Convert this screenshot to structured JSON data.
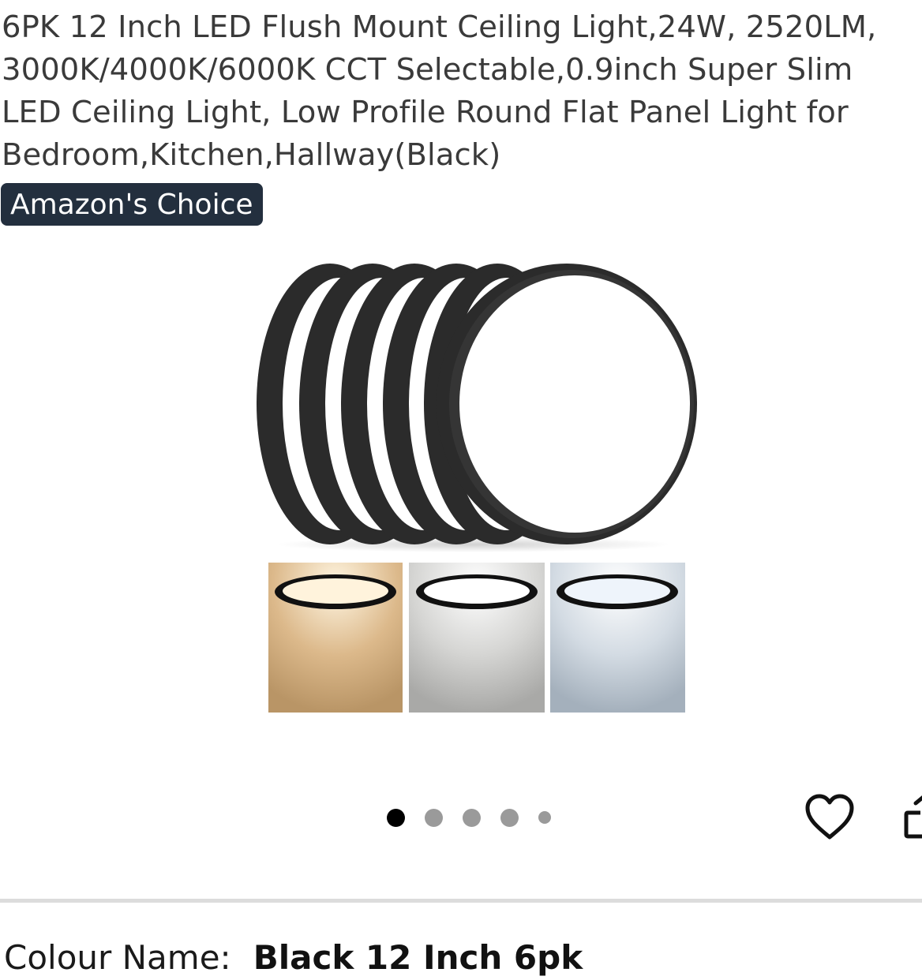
{
  "product": {
    "title": "6PK 12 Inch LED Flush Mount Ceiling Light,24W, 2520LM, 3000K/4000K/6000K CCT Selectable,0.9inch Super Slim LED Ceiling Light, Low Profile Round Flat Panel Light for Bedroom,Kitchen,Hallway(Black)",
    "badge": "Amazon's Choice"
  },
  "gallery": {
    "image_count": 5,
    "active_index": 0,
    "swatch_tints": [
      "#e8c9a0",
      "#dcdcdc",
      "#cfd8e2"
    ]
  },
  "actions": {
    "favorite_icon": "heart-icon",
    "share_icon": "share-icon"
  },
  "variation": {
    "label": "Colour Name:",
    "value": "Black 12 Inch 6pk"
  },
  "colors": {
    "badge_bg": "#232f3e",
    "badge_text": "#ffffff",
    "dot_active": "#000000",
    "dot_inactive": "#9a9a9a",
    "divider": "#dcdcdc"
  }
}
